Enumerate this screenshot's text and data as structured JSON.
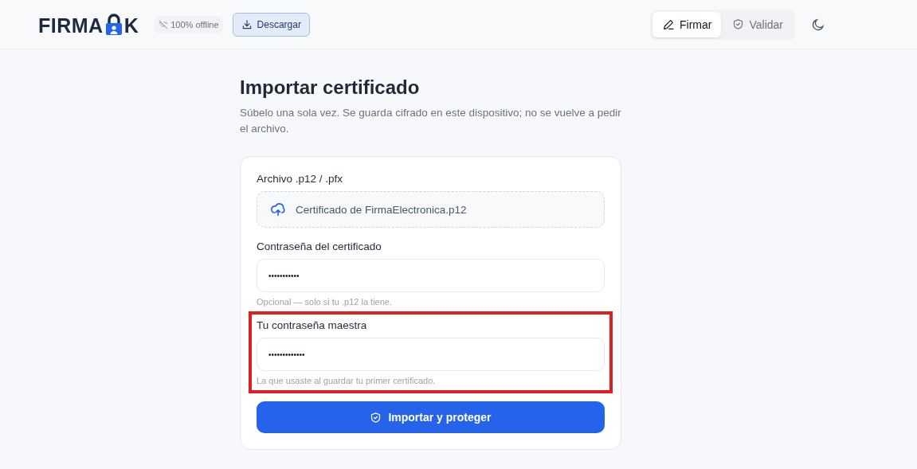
{
  "header": {
    "logo_start": "FIRMA",
    "logo_end": "K",
    "offline_badge": "100% offline",
    "download_button": "Descargar",
    "nav": [
      {
        "label": "Firmar",
        "kind": "sign",
        "selected": true
      },
      {
        "label": "Validar",
        "kind": "validate",
        "selected": false
      }
    ]
  },
  "page": {
    "title": "Importar certificado",
    "subtitle": "Súbelo una sola vez. Se guarda cifrado en este dispositivo; no se vuelve a pedir el archivo."
  },
  "form": {
    "fields": [
      {
        "kind": "file",
        "label": "Archivo .p12 / .pfx",
        "value": "Certificado de FirmaElectronica.p12",
        "highlighted": false
      },
      {
        "kind": "password",
        "label": "Contraseña del certificado",
        "value": "•••••••••••",
        "hint": "Opcional — solo si tu .p12 la tiene.",
        "highlighted": false
      },
      {
        "kind": "password",
        "label": "Tu contraseña maestra",
        "value": "•••••••••••••",
        "hint": "La que usaste al guardar tu primer certificado.",
        "highlighted": true
      }
    ],
    "submit": "Importar y proteger"
  }
}
